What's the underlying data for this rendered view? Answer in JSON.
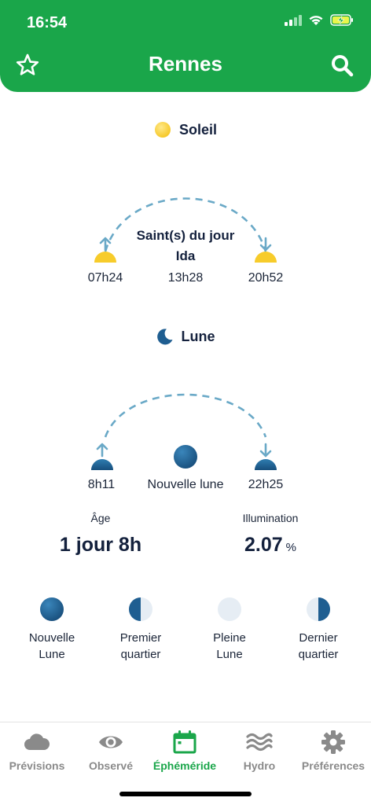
{
  "status": {
    "time": "16:54"
  },
  "header": {
    "title": "Rennes"
  },
  "sun": {
    "section_title": "Soleil",
    "saints_label": "Saint(s) du jour",
    "saints_name": "Ida",
    "rise": "07h24",
    "noon": "13h28",
    "set": "20h52"
  },
  "moon": {
    "section_title": "Lune",
    "rise": "8h11",
    "phase_name": "Nouvelle lune",
    "set": "22h25",
    "age_label": "Âge",
    "age_value": "1 jour 8h",
    "illumination_label": "Illumination",
    "illumination_value": "2.07",
    "illumination_unit": "%"
  },
  "phases": [
    {
      "line1": "Nouvelle",
      "line2": "Lune"
    },
    {
      "line1": "Premier",
      "line2": "quartier"
    },
    {
      "line1": "Pleine",
      "line2": "Lune"
    },
    {
      "line1": "Dernier",
      "line2": "quartier"
    }
  ],
  "tabs": [
    {
      "label": "Prévisions",
      "icon": "cloud-icon"
    },
    {
      "label": "Observé",
      "icon": "eye-icon"
    },
    {
      "label": "Éphéméride",
      "icon": "calendar-icon",
      "active": true
    },
    {
      "label": "Hydro",
      "icon": "waves-icon"
    },
    {
      "label": "Préférences",
      "icon": "gear-icon"
    }
  ],
  "colors": {
    "brand_green": "#1aa64a",
    "sun_yellow": "#f7cc2b",
    "moon_blue": "#1f5e91",
    "arc_blue": "#6aa9c7",
    "tab_inactive": "#8a8a8a"
  }
}
